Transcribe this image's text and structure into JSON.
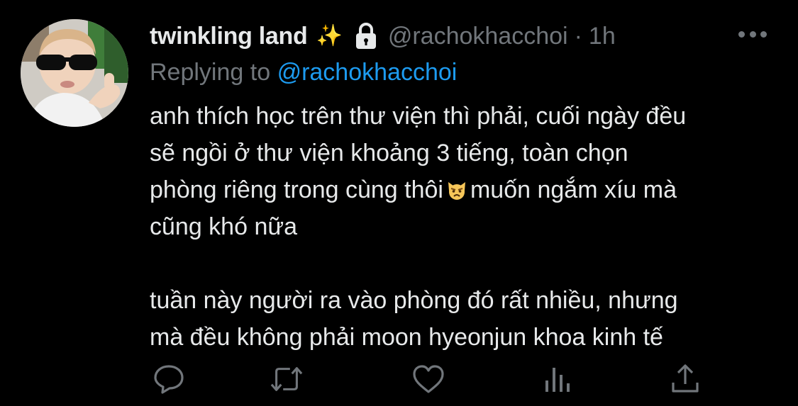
{
  "tweet": {
    "display_name": "twinkling land",
    "sparkle_emoji": "✨",
    "handle": "@rachokhacchoi",
    "separator": "·",
    "time": "1h",
    "replying_label": "Replying to",
    "replying_mention": "@rachokhacchoi",
    "body": {
      "line1": "anh thích học trên thư viện thì phải, cuối ngày đều",
      "line2": "sẽ ngồi ở thư viện khoảng 3 tiếng, toàn chọn",
      "line3_a": "phòng riêng trong cùng thôi",
      "line3_b": "muốn ngắm xíu mà",
      "line4": "cũng khó nữa",
      "line5": "tuần này người ra vào phòng đó rất nhiều, nhưng",
      "line6": "mà đều không phải moon hyeonjun khoa kinh tế"
    }
  },
  "icons": {
    "avatar": "profile-avatar",
    "sparkle": "sparkles-icon",
    "lock": "lock-icon",
    "more": "more-options-icon",
    "inline_emoji": "pouting-cat-emoji",
    "reply": "reply-icon",
    "retweet": "retweet-icon",
    "like": "like-icon",
    "views": "views-icon",
    "share": "share-icon"
  },
  "colors": {
    "background": "#000000",
    "text": "#e7e9ea",
    "muted": "#71767b",
    "link": "#1d9bf0",
    "sparkle": "#f5c74a"
  }
}
